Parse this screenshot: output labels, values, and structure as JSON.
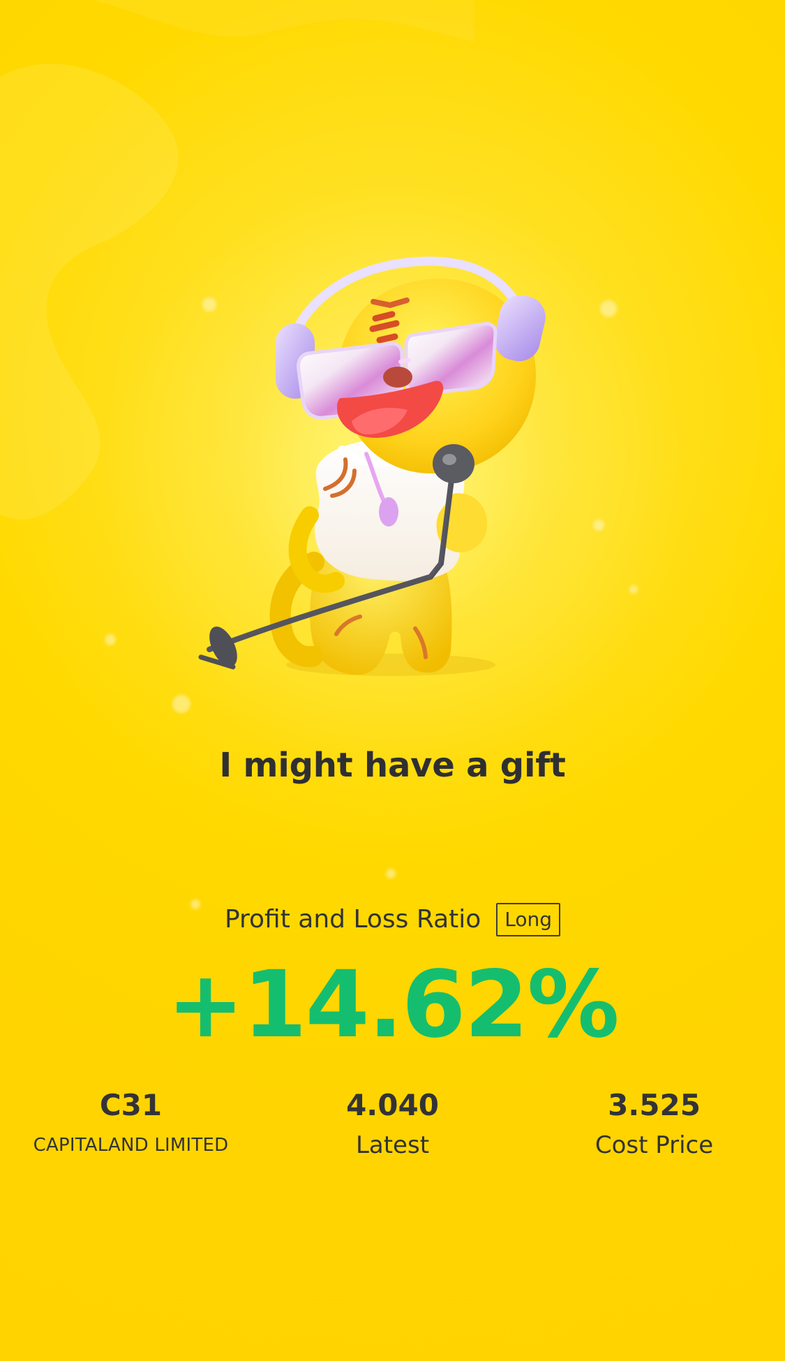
{
  "theme": {
    "background": "#ffd300",
    "text_color": "#333336",
    "accent_green": "#15be6f"
  },
  "headline": "I might have a gift",
  "profit_loss": {
    "label": "Profit and Loss Ratio",
    "position_type": "Long",
    "value": "+14.62%"
  },
  "stats": [
    {
      "value": "C31",
      "label": "CAPITALAND LIMITED"
    },
    {
      "value": "4.040",
      "label": "Latest"
    },
    {
      "value": "3.525",
      "label": "Cost Price"
    }
  ],
  "icons": {
    "mascot": "tiger-mascot-illustration"
  }
}
